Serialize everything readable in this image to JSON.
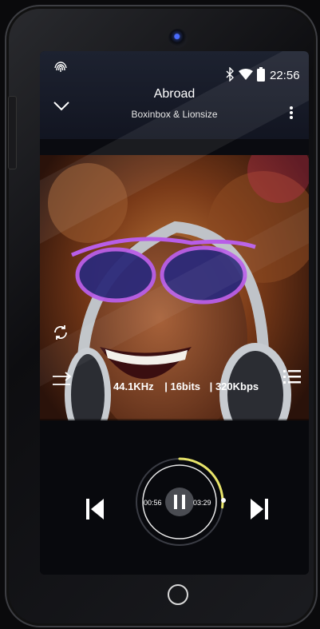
{
  "status": {
    "time": "22:56"
  },
  "track": {
    "title": "Abroad",
    "artist": "Boxinbox & Lionsize"
  },
  "quality": {
    "sample_rate": "44.1KHz",
    "bit_depth": "16bits",
    "bitrate": "320Kbps",
    "sep": "|"
  },
  "progress": {
    "elapsed": "00:56",
    "total": "03:29",
    "fraction": 0.27
  },
  "colors": {
    "accent": "#e8e46a",
    "bezel": "#2a2b2f",
    "screen": "#0a0b10"
  },
  "icons": {
    "app": "fingerprint-icon",
    "collapse": "chevron-down-icon",
    "bluetooth": "bluetooth-icon",
    "wifi": "wifi-icon",
    "battery": "battery-icon",
    "menu": "more-vertical-icon",
    "repeat": "repeat-icon",
    "shuffle": "shuffle-icon",
    "playlist": "playlist-icon",
    "prev": "skip-previous-icon",
    "pause": "pause-icon",
    "next": "skip-next-icon",
    "home": "home-icon"
  }
}
